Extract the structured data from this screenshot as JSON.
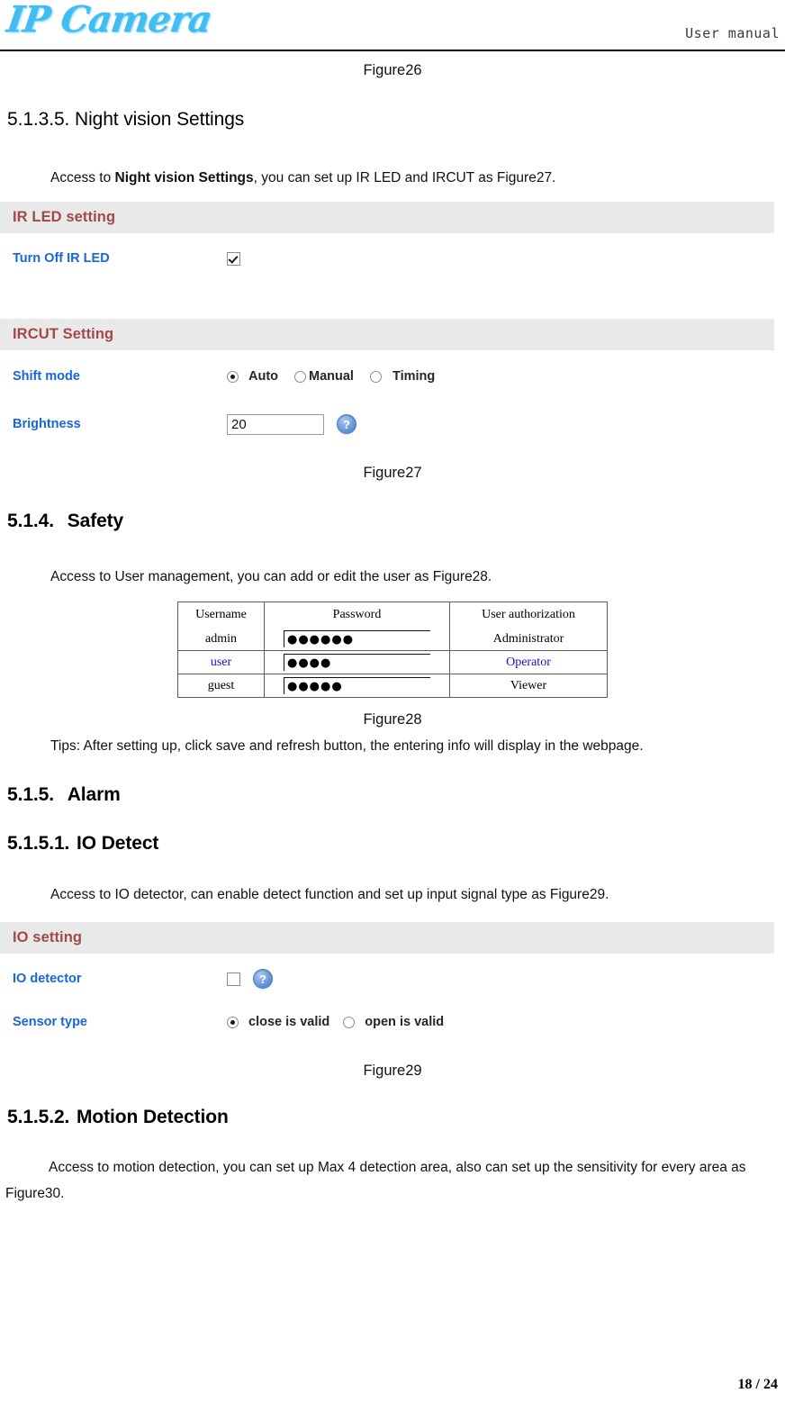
{
  "header": {
    "logo_text": "IP Camera",
    "manual_label": "User manual"
  },
  "captions": {
    "figure26": "Figure26",
    "figure27": "Figure27",
    "figure28": "Figure28",
    "figure29": "Figure29"
  },
  "sections": [
    {
      "number": "5.1.3.5.",
      "title": "Night vision Settings",
      "bold": false,
      "paragraph_prefix": "Access to ",
      "paragraph_strong": "Night vision Settings",
      "paragraph_suffix": ", you can set up IR LED and IRCUT as Figure27."
    },
    {
      "number": "5.1.4.",
      "title": "Safety",
      "bold": true,
      "paragraph": "Access to User management, you can add or edit the user as Figure28.",
      "tips": "Tips: After setting up, click save and refresh button, the entering info will display in the webpage."
    },
    {
      "number": "5.1.5.",
      "title": "Alarm",
      "bold": true
    },
    {
      "number": "5.1.5.1.",
      "title": "IO Detect",
      "bold": true,
      "paragraph": "Access to IO detector, can enable detect function and set up input signal type as Figure29."
    },
    {
      "number": "5.1.5.2.",
      "title": "Motion Detection",
      "bold": true,
      "paragraph": "Access to motion detection, you can set up Max 4 detection area, also can set up the sensitivity for every area as Figure30."
    }
  ],
  "ir_led_panel": {
    "title": "IR LED setting",
    "row_label": "Turn Off IR LED",
    "checkbox_checked": true
  },
  "ircut_panel": {
    "title": "IRCUT Setting",
    "shift_mode_label": "Shift mode",
    "shift_mode_options": [
      {
        "label": "Auto",
        "selected": true
      },
      {
        "label": "Manual",
        "selected": false
      },
      {
        "label": "Timing",
        "selected": false
      }
    ],
    "brightness_label": "Brightness",
    "brightness_value": "20",
    "help_glyph": "?"
  },
  "user_table": {
    "columns": [
      "Username",
      "Password",
      "User authorization"
    ],
    "rows": [
      {
        "username": "admin",
        "password_dots": "●●●●●●",
        "authorization": "Administrator",
        "highlight": false
      },
      {
        "username": "user",
        "password_dots": "●●●●",
        "authorization": "Operator",
        "highlight": true
      },
      {
        "username": "guest",
        "password_dots": "●●●●●",
        "authorization": "Viewer",
        "highlight": false
      }
    ]
  },
  "io_panel": {
    "title": "IO setting",
    "detector_label": "IO detector",
    "detector_checked": false,
    "help_glyph": "?",
    "sensor_label": "Sensor type",
    "sensor_options": [
      {
        "label": "close is valid",
        "selected": true
      },
      {
        "label": "open is valid",
        "selected": false
      }
    ]
  },
  "footer": {
    "page": "18 / 24"
  },
  "colors": {
    "logo_blue": "#41BDF2",
    "panel_header_bg": "#e9e9e9",
    "panel_header_text": "#A4474A",
    "panel_label_blue": "#1766E0",
    "table_highlight_blue": "#1212C8"
  }
}
